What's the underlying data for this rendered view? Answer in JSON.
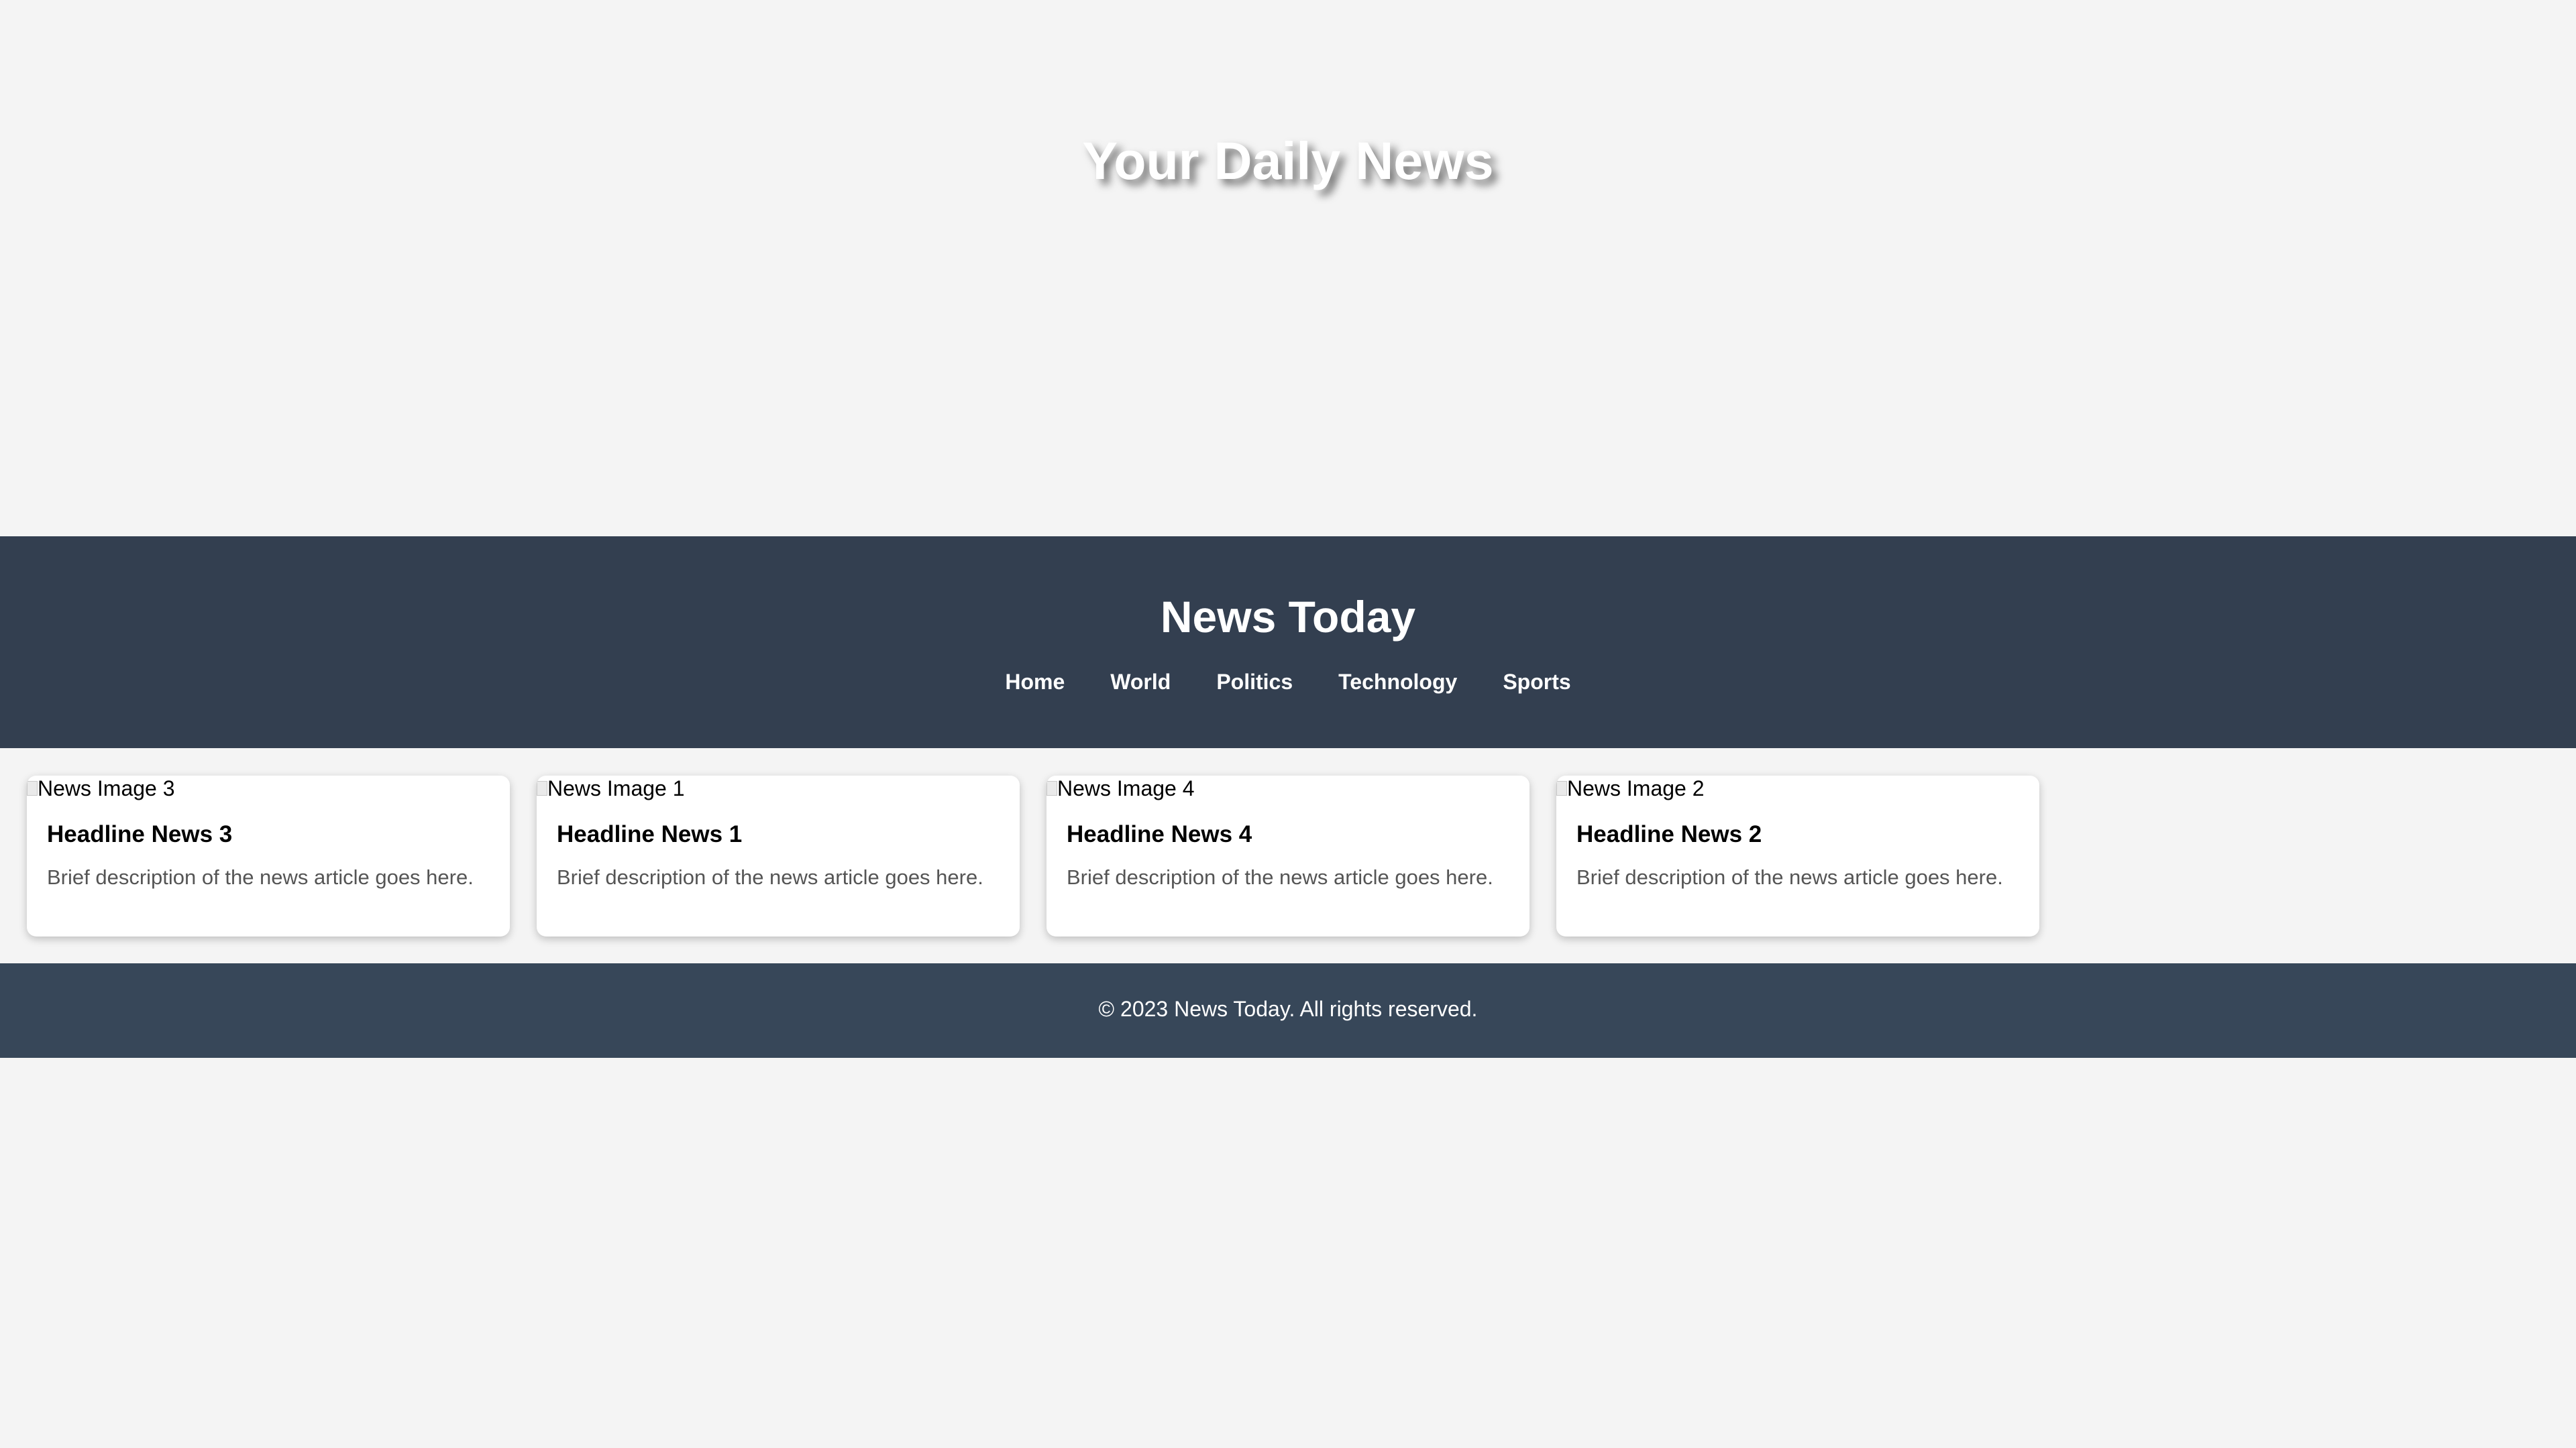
{
  "hero": {
    "title": "Your Daily News"
  },
  "header": {
    "site_title": "News Today",
    "nav": [
      {
        "label": "Home"
      },
      {
        "label": "World"
      },
      {
        "label": "Politics"
      },
      {
        "label": "Technology"
      },
      {
        "label": "Sports"
      }
    ]
  },
  "articles": [
    {
      "image_alt": "News Image 3",
      "headline": "Headline News 3",
      "description": "Brief description of the news article goes here."
    },
    {
      "image_alt": "News Image 1",
      "headline": "Headline News 1",
      "description": "Brief description of the news article goes here."
    },
    {
      "image_alt": "News Image 4",
      "headline": "Headline News 4",
      "description": "Brief description of the news article goes here."
    },
    {
      "image_alt": "News Image 2",
      "headline": "Headline News 2",
      "description": "Brief description of the news article goes here."
    }
  ],
  "footer": {
    "text": "© 2023 News Today. All rights reserved."
  },
  "colors": {
    "page_bg": "#f4f4f4",
    "header_bg": "#333f50",
    "footer_bg": "#374759",
    "card_bg": "#ffffff",
    "description_text": "#555555"
  },
  "icons": {
    "broken_image": "broken-image-icon"
  }
}
